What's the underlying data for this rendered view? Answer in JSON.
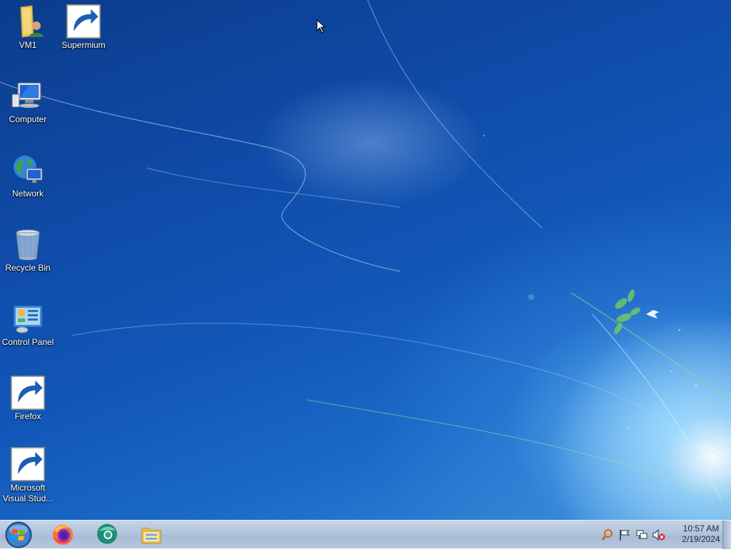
{
  "desktop": {
    "icons": [
      {
        "label": "VM1",
        "icon": "user-folder-icon"
      },
      {
        "label": "Supermium",
        "icon": "supermium-icon"
      },
      {
        "label": "Computer",
        "icon": "computer-icon"
      },
      {
        "label": "Network",
        "icon": "network-icon"
      },
      {
        "label": "Recycle Bin",
        "icon": "recycle-bin-icon"
      },
      {
        "label": "Control Panel",
        "icon": "control-panel-icon"
      },
      {
        "label": "Firefox",
        "icon": "firefox-icon"
      },
      {
        "label": "Microsoft Visual Stud...",
        "icon": "visual-studio-icon"
      }
    ]
  },
  "taskbar": {
    "start": {
      "icon": "windows-start-icon"
    },
    "pinned": [
      {
        "name": "Firefox",
        "icon": "firefox-icon"
      },
      {
        "name": "Supermium",
        "icon": "supermium-icon"
      },
      {
        "name": "Windows Explorer",
        "icon": "file-explorer-icon"
      }
    ],
    "tray": {
      "icons": [
        "search-icon",
        "flag-icon",
        "network-status-icon",
        "volume-muted-icon"
      ],
      "time": "10:57 AM",
      "date": "2/19/2024"
    }
  },
  "colors": {
    "desktop_blue": "#1257b8",
    "taskbar": "#b4c6dc"
  }
}
